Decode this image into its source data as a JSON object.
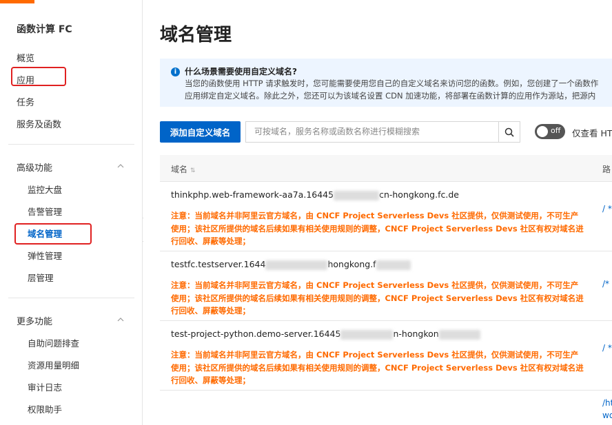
{
  "sidebar": {
    "product_title": "函数计算 FC",
    "top_items": [
      "概览",
      "应用",
      "任务",
      "服务及函数"
    ],
    "advanced": {
      "title": "高级功能",
      "items": [
        "监控大盘",
        "告警管理",
        "域名管理",
        "弹性管理",
        "层管理"
      ]
    },
    "more": {
      "title": "更多功能",
      "items": [
        "自助问题排查",
        "资源用量明细",
        "审计日志",
        "权限助手"
      ]
    }
  },
  "main": {
    "title": "域名管理",
    "info": {
      "icon": "info-icon",
      "title": "什么场景需要使用自定义域名?",
      "line1": "当您的函数使用 HTTP 请求触发时，您可能需要使用您自己的自定义域名来访问您的函数。例如，您创建了一个函数作",
      "line2": "应用绑定自定义域名。除此之外，您还可以为该域名设置 CDN 加速功能，将部署在函数计算的应用作为源站，把源内"
    },
    "add_button": "添加自定义域名",
    "search_placeholder": "可按域名，服务名称或函数名称进行模糊搜索",
    "toggle": {
      "state": "off",
      "label": "仅查看 HTT"
    },
    "columns": {
      "domain": "域名",
      "path": "路"
    },
    "rows": [
      {
        "domain_prefix": "thinkphp.web-framework-aa7a.16445",
        "domain_suffix": "cn-hongkong.fc.de",
        "path": "/ *",
        "warning": "注意：当前域名并非阿里云官方域名，由 CNCF Project Serverless Devs 社区提供，仅供测试使用，不可生产使用；该社区所提供的域名后续如果有相关使用规则的调整，CNCF Project Serverless Devs 社区有权对域名进行回收、屏蔽等处理；"
      },
      {
        "domain_prefix": "testfc.testserver.1644",
        "domain_suffix": "hongkong.f",
        "path": "/*",
        "warning": "注意：当前域名并非阿里云官方域名，由 CNCF Project Serverless Devs 社区提供，仅供测试使用，不可生产使用；该社区所提供的域名后续如果有相关使用规则的调整，CNCF Project Serverless Devs 社区有权对域名进行回收、屏蔽等处理；"
      },
      {
        "domain_prefix": "test-project-python.demo-server.16445",
        "domain_suffix": "n-hongkon",
        "path": "/ *",
        "warning": "注意：当前域名并非阿里云官方域名，由 CNCF Project Serverless Devs 社区提供，仅供测试使用，不可生产使用；该社区所提供的域名后续如果有相关使用规则的调整，CNCF Project Serverless Devs 社区有权对域名进行回收、屏蔽等处理；"
      }
    ],
    "tail_path_line1": "/ht",
    "tail_path_line2": "wo"
  },
  "colors": {
    "primary": "#0064c8",
    "warning": "#ff6a00",
    "highlight": "#e02020"
  }
}
